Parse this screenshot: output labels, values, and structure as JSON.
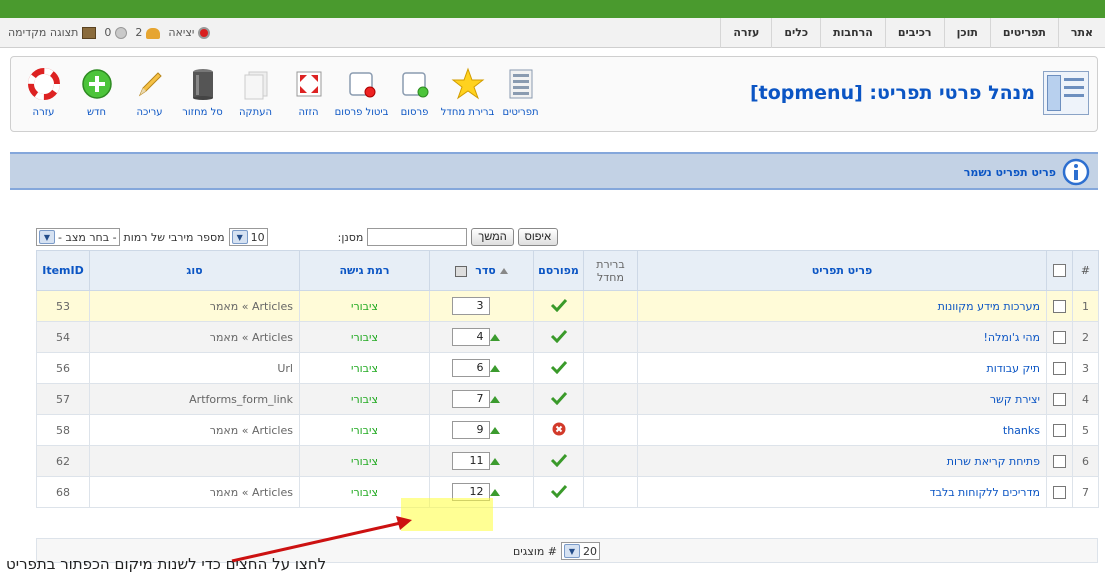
{
  "menu": {
    "items": [
      "אתר",
      "תפריטים",
      "תוכן",
      "רכיבים",
      "הרחבות",
      "כלים",
      "עזרה"
    ]
  },
  "status": {
    "preview": "תצוגה מקדימה",
    "messages_count": "0",
    "users_count": "2",
    "logout": "יציאה"
  },
  "header": {
    "title": "מנהל פרטי תפריט: [topmenu]"
  },
  "toolbar": {
    "items": [
      {
        "label": "עזרה",
        "icon": "help-icon"
      },
      {
        "label": "חדש",
        "icon": "new-icon"
      },
      {
        "label": "עריכה",
        "icon": "edit-icon"
      },
      {
        "label": "סל מחזור",
        "icon": "trash-icon"
      },
      {
        "label": "העתקה",
        "icon": "copy-icon"
      },
      {
        "label": "הזזה",
        "icon": "move-icon"
      },
      {
        "label": "ביטול פרסום",
        "icon": "unpublish-icon"
      },
      {
        "label": "פרסום",
        "icon": "publish-icon"
      },
      {
        "label": "ברירת מחדל",
        "icon": "default-star-icon"
      },
      {
        "label": "תפריטים",
        "icon": "menus-icon"
      }
    ]
  },
  "message": {
    "text": "פריט תפריט נשמר"
  },
  "filters": {
    "filter_label": "מסנן:",
    "filter_value": "",
    "go_label": "המשך",
    "reset_label": "איפוס",
    "levels_label": "מספר מירבי של רמות",
    "levels_value": "10",
    "state_select": "- בחר מצב -"
  },
  "table": {
    "headers": {
      "num": "#",
      "name": "פריט תפריט",
      "default": "ברירת מחדל",
      "published": "מפורסם",
      "order": "סדר",
      "access": "רמת גישה",
      "type": "סוג",
      "itemid": "ItemID"
    },
    "rows": [
      {
        "num": "1",
        "name": "מערכות מידע מקוונות",
        "published": true,
        "order": "3",
        "access": "ציבורי",
        "type": "Articles » מאמר",
        "itemid": "53"
      },
      {
        "num": "2",
        "name": "מהי ג'ומלה!",
        "published": true,
        "order": "4",
        "access": "ציבורי",
        "type": "Articles » מאמר",
        "itemid": "54"
      },
      {
        "num": "3",
        "name": "תיק עבודות",
        "published": true,
        "order": "6",
        "access": "ציבורי",
        "type": "Url",
        "itemid": "56"
      },
      {
        "num": "4",
        "name": "יצירת קשר",
        "published": true,
        "order": "7",
        "access": "ציבורי",
        "type": "Artforms_form_link",
        "itemid": "57"
      },
      {
        "num": "5",
        "name": "thanks",
        "published": false,
        "order": "9",
        "access": "ציבורי",
        "type": "Articles » מאמר",
        "itemid": "58"
      },
      {
        "num": "6",
        "name": "פתיחת קריאת שרות",
        "published": true,
        "order": "11",
        "access": "ציבורי",
        "type": "",
        "itemid": "62"
      },
      {
        "num": "7",
        "name": "מדריכים ללקוחות בלבד",
        "published": true,
        "order": "12",
        "access": "ציבורי",
        "type": "Articles » מאמר",
        "itemid": "68"
      }
    ]
  },
  "pagination": {
    "label": "# מוצגים",
    "value": "20"
  },
  "annotation": {
    "text": "לחצו על החצים כדי לשנות מיקום הכפתור בתפריט"
  },
  "colors": {
    "link_blue": "#0b55c4",
    "top_green": "#4a9a2e",
    "public_green": "#22aa22",
    "highlight_yellow": "#ffff3c",
    "annotation_red": "#cc1111"
  }
}
